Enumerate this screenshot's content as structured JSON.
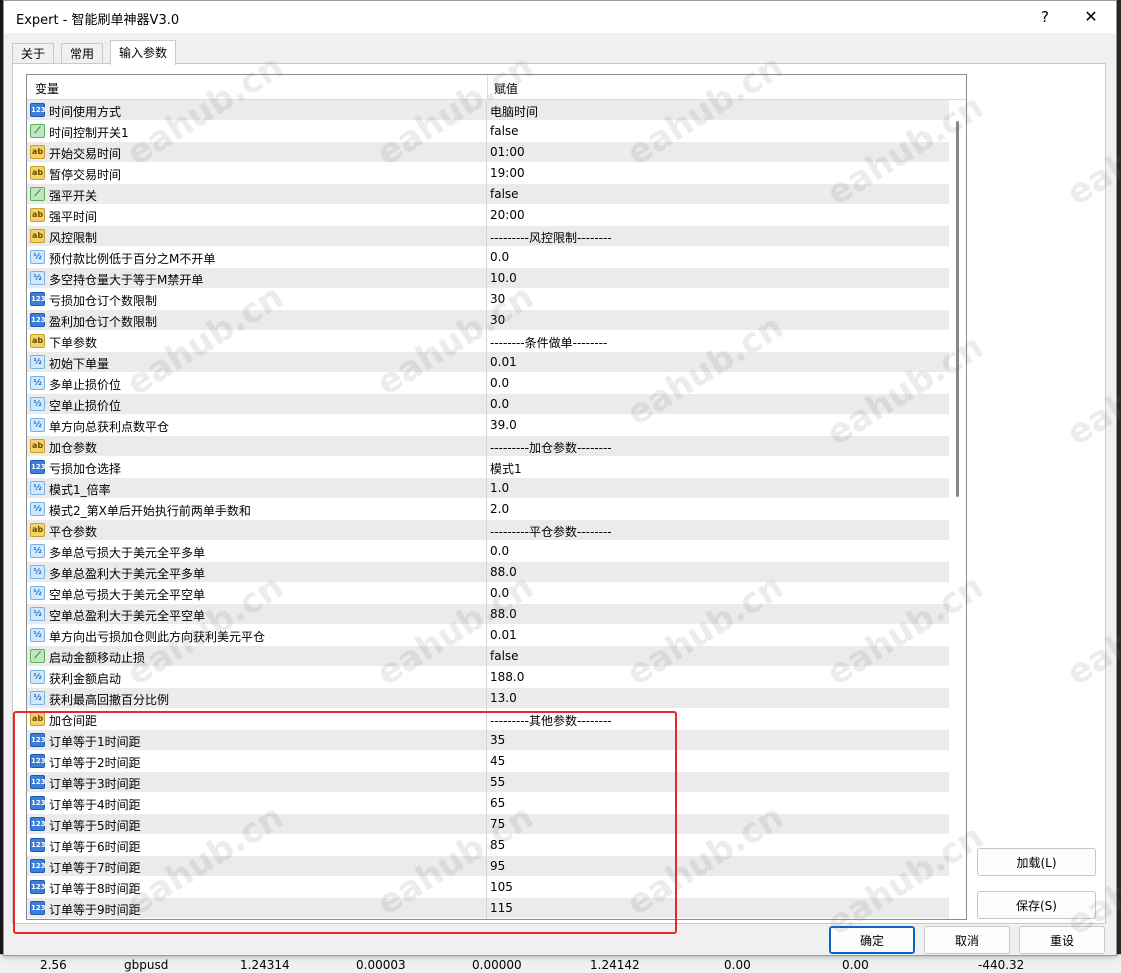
{
  "window": {
    "title": "Expert - 智能刷单神器V3.0",
    "help_label": "?",
    "close_label": "✕"
  },
  "tabs": [
    {
      "label": "关于"
    },
    {
      "label": "常用"
    },
    {
      "label": "输入参数"
    }
  ],
  "grid": {
    "col_variable": "变量",
    "col_value": "赋值",
    "rows": [
      {
        "icon": "int-icon",
        "badge": "123",
        "name": "时间使用方式",
        "value": "电脑时间"
      },
      {
        "icon": "bool-icon",
        "badge": "⟋",
        "name": "时间控制开关1",
        "value": "false"
      },
      {
        "icon": "string-icon",
        "badge": "ab",
        "name": "开始交易时间",
        "value": "01:00"
      },
      {
        "icon": "string-icon",
        "badge": "ab",
        "name": "暂停交易时间",
        "value": "19:00"
      },
      {
        "icon": "bool-icon",
        "badge": "⟋",
        "name": "强平开关",
        "value": "false"
      },
      {
        "icon": "string-icon",
        "badge": "ab",
        "name": "强平时间",
        "value": "20:00"
      },
      {
        "icon": "string-icon",
        "badge": "ab",
        "name": "风控限制",
        "value": "---------风控限制--------"
      },
      {
        "icon": "double-icon",
        "badge": "½",
        "name": "预付款比例低于百分之M不开单",
        "value": "0.0"
      },
      {
        "icon": "double-icon",
        "badge": "½",
        "name": "多空持仓量大于等于M禁开单",
        "value": "10.0"
      },
      {
        "icon": "int-icon",
        "badge": "123",
        "name": "亏损加仓订个数限制",
        "value": "30"
      },
      {
        "icon": "int-icon",
        "badge": "123",
        "name": "盈利加仓订个数限制",
        "value": "30"
      },
      {
        "icon": "string-icon",
        "badge": "ab",
        "name": "下单参数",
        "value": "--------条件做单--------"
      },
      {
        "icon": "double-icon",
        "badge": "½",
        "name": "初始下单量",
        "value": "0.01"
      },
      {
        "icon": "double-icon",
        "badge": "½",
        "name": "多单止损价位",
        "value": "0.0"
      },
      {
        "icon": "double-icon",
        "badge": "½",
        "name": "空单止损价位",
        "value": "0.0"
      },
      {
        "icon": "double-icon",
        "badge": "½",
        "name": "单方向总获利点数平仓",
        "value": "39.0"
      },
      {
        "icon": "string-icon",
        "badge": "ab",
        "name": "加仓参数",
        "value": "---------加仓参数--------"
      },
      {
        "icon": "int-icon",
        "badge": "123",
        "name": "亏损加仓选择",
        "value": "模式1"
      },
      {
        "icon": "double-icon",
        "badge": "½",
        "name": "模式1_倍率",
        "value": "1.0"
      },
      {
        "icon": "double-icon",
        "badge": "½",
        "name": "模式2_第X单后开始执行前两单手数和",
        "value": "2.0"
      },
      {
        "icon": "string-icon",
        "badge": "ab",
        "name": "平仓参数",
        "value": "---------平仓参数--------"
      },
      {
        "icon": "double-icon",
        "badge": "½",
        "name": "多单总亏损大于美元全平多单",
        "value": "0.0"
      },
      {
        "icon": "double-icon",
        "badge": "½",
        "name": "多单总盈利大于美元全平多单",
        "value": "88.0"
      },
      {
        "icon": "double-icon",
        "badge": "½",
        "name": "空单总亏损大于美元全平空单",
        "value": "0.0"
      },
      {
        "icon": "double-icon",
        "badge": "½",
        "name": "空单总盈利大于美元全平空单",
        "value": "88.0"
      },
      {
        "icon": "double-icon",
        "badge": "½",
        "name": "单方向出亏损加仓则此方向获利美元平仓",
        "value": "0.01"
      },
      {
        "icon": "bool-icon",
        "badge": "⟋",
        "name": "启动金额移动止损",
        "value": "false"
      },
      {
        "icon": "double-icon",
        "badge": "½",
        "name": "获利金额启动",
        "value": "188.0"
      },
      {
        "icon": "double-icon",
        "badge": "½",
        "name": "获利最高回撤百分比例",
        "value": "13.0"
      },
      {
        "icon": "string-icon",
        "badge": "ab",
        "name": "加仓间距",
        "value": "---------其他参数--------"
      },
      {
        "icon": "int-icon",
        "badge": "123",
        "name": "订单等于1时间距",
        "value": "35"
      },
      {
        "icon": "int-icon",
        "badge": "123",
        "name": "订单等于2时间距",
        "value": "45"
      },
      {
        "icon": "int-icon",
        "badge": "123",
        "name": "订单等于3时间距",
        "value": "55"
      },
      {
        "icon": "int-icon",
        "badge": "123",
        "name": "订单等于4时间距",
        "value": "65"
      },
      {
        "icon": "int-icon",
        "badge": "123",
        "name": "订单等于5时间距",
        "value": "75"
      },
      {
        "icon": "int-icon",
        "badge": "123",
        "name": "订单等于6时间距",
        "value": "85"
      },
      {
        "icon": "int-icon",
        "badge": "123",
        "name": "订单等于7时间距",
        "value": "95"
      },
      {
        "icon": "int-icon",
        "badge": "123",
        "name": "订单等于8时间距",
        "value": "105"
      },
      {
        "icon": "int-icon",
        "badge": "123",
        "name": "订单等于9时间距",
        "value": "115"
      }
    ]
  },
  "buttons": {
    "load": "加载(L)",
    "save": "保存(S)",
    "ok": "确定",
    "cancel": "取消",
    "reset": "重设"
  },
  "background_status_row": [
    "2.56",
    "gbpusd",
    "1.24314",
    "0.00003",
    "0.00000",
    "1.24142",
    "0.00",
    "0.00",
    "-440.32"
  ],
  "watermark_text": "eahub.cn",
  "colors": {
    "highlight_border": "#e8282b",
    "row_alt": "#ebebeb",
    "primary_border": "#0a64c8"
  }
}
